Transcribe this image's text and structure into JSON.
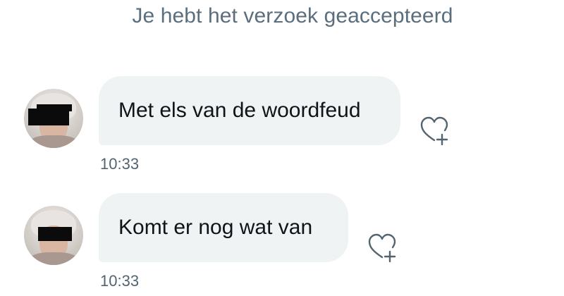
{
  "system_note": "Je hebt het verzoek geaccepteerd",
  "messages": [
    {
      "text": "Met els van de woordfeud",
      "time": "10:33",
      "react_icon": "heart-plus-icon"
    },
    {
      "text": "Komt er nog wat van",
      "time": "10:33",
      "react_icon": "heart-plus-icon"
    }
  ],
  "colors": {
    "bubble": "#eff3f4",
    "text": "#0f1419",
    "muted": "#536471",
    "system_note": "#5b6e7e"
  }
}
